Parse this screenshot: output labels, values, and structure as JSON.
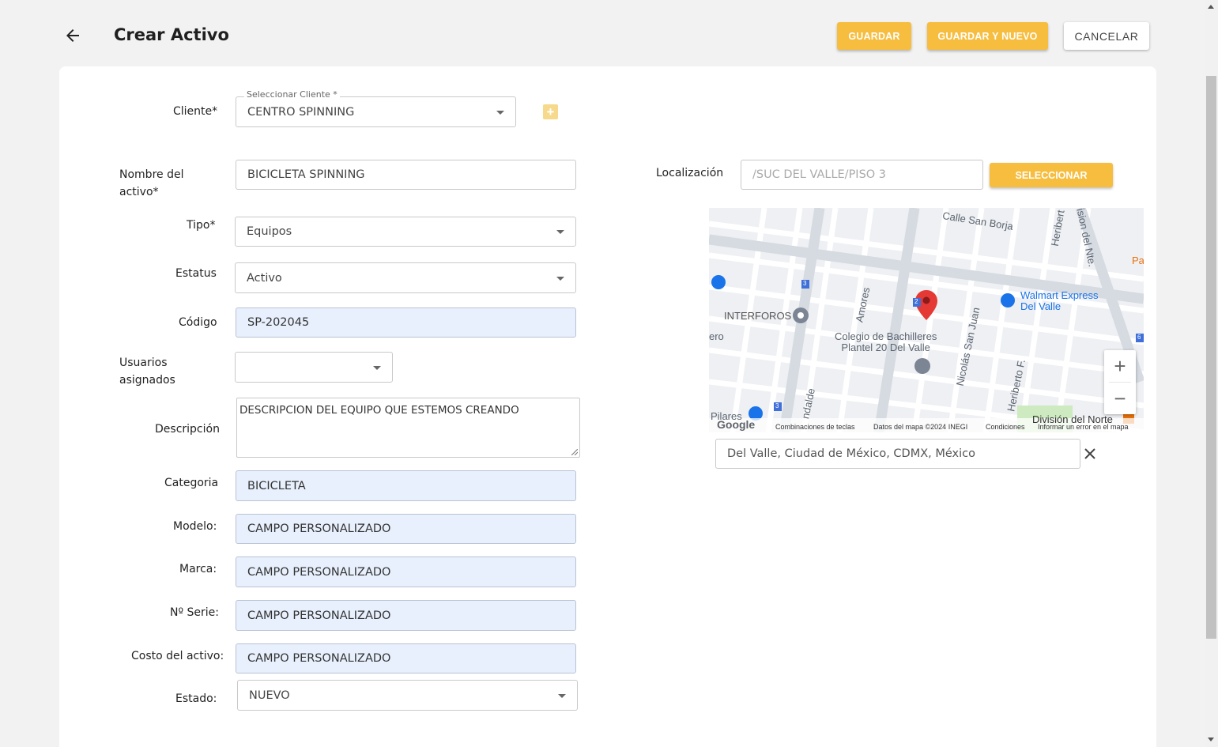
{
  "header": {
    "title": "Crear Activo",
    "save_label": "GUARDAR",
    "save_new_label": "GUARDAR Y NUEVO",
    "cancel_label": "CANCELAR"
  },
  "form": {
    "cliente": {
      "label": "Cliente*",
      "float_label": "Seleccionar Cliente *",
      "value": "CENTRO SPINNING"
    },
    "nombre": {
      "label_line1": "Nombre del",
      "label_line2": "activo*",
      "value": "BICICLETA SPINNING"
    },
    "tipo": {
      "label": "Tipo*",
      "value": "Equipos"
    },
    "estatus": {
      "label": "Estatus",
      "value": "Activo"
    },
    "codigo": {
      "label": "Código",
      "value": "SP-202045"
    },
    "usuarios": {
      "label_line1": "Usuarios",
      "label_line2": "asignados",
      "value": ""
    },
    "descripcion": {
      "label": "Descripción",
      "value": "DESCRIPCION DEL EQUIPO QUE ESTEMOS CREANDO"
    },
    "categoria": {
      "label": "Categoria",
      "value": "BICICLETA"
    },
    "modelo": {
      "label": "Modelo:",
      "value": "CAMPO PERSONALIZADO"
    },
    "marca": {
      "label": "Marca:",
      "value": "CAMPO PERSONALIZADO"
    },
    "serie": {
      "label": "Nº Serie:",
      "value": "CAMPO PERSONALIZADO"
    },
    "costo": {
      "label": "Costo del activo:",
      "value": "CAMPO PERSONALIZADO"
    },
    "estado": {
      "label": "Estado:",
      "value": "NUEVO"
    }
  },
  "location": {
    "label": "Localización",
    "placeholder": "/SUC DEL VALLE/PISO 3",
    "select_label": "SELECCIONAR",
    "search_value": "Del Valle, Ciudad de México, CDMX, México"
  },
  "map": {
    "labels": {
      "calle_san_borja": "Calle San Borja",
      "heribert": "Heribert",
      "ision_del_nte": "ision del Nte.",
      "pa": "Pa",
      "walmart_1": "Walmart Express",
      "walmart_2": "Del Valle",
      "interforos": "INTERFOROS",
      "amores": "Amores",
      "colegio_1": "Colegio de Bachilleres",
      "colegio_2": "Plantel 20 Del Valle",
      "nicolas": "Nicolás San Juan",
      "ero": "ero",
      "heriberto_f": "Heriberto F.",
      "ndalde": "ndalde",
      "pilares": "Pilares",
      "division": "División del Norte",
      "route_3a": "3",
      "route_2": "2",
      "route_6": "6",
      "route_3b": "3"
    },
    "footer": {
      "google": "Google",
      "keys": "Combinaciones de teclas",
      "data": "Datos del mapa ©2024 INEGI",
      "terms": "Condiciones",
      "report": "Informar un error en el mapa"
    },
    "zoom_in": "+",
    "zoom_out": "−"
  },
  "colors": {
    "accent": "#f6bd3f",
    "filled_field": "#e8f0fd",
    "pin": "#e53935",
    "poi_blue": "#1a73e8"
  }
}
